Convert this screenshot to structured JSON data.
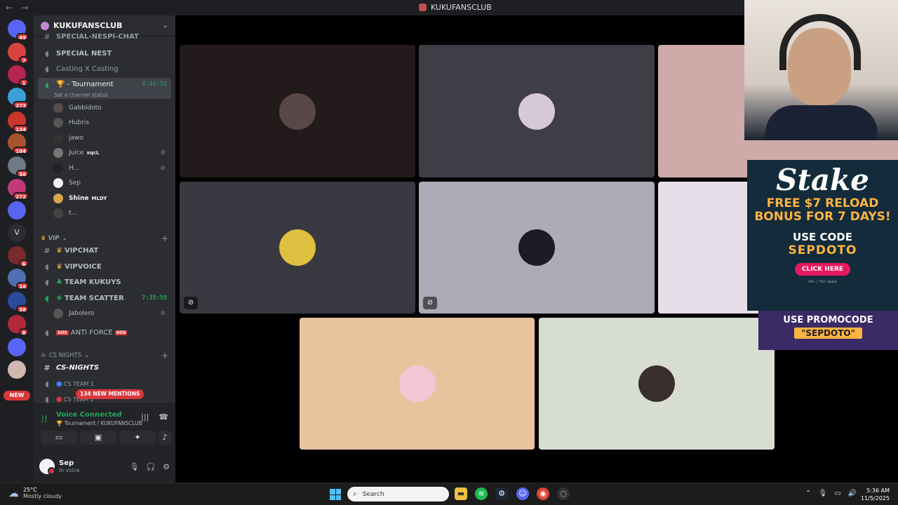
{
  "window": {
    "title": "KUKUFANSCLUB",
    "back": "←",
    "forward": "→"
  },
  "rail": {
    "dm_badge": "49",
    "servers": [
      {
        "badge": "7",
        "color": "#d8433f"
      },
      {
        "badge": "1",
        "color": "#b4254f"
      },
      {
        "badge": "273",
        "color": "#3aa0d8"
      },
      {
        "badge": "134",
        "color": "#c9372c"
      },
      {
        "badge": "104",
        "color": "#a8542f"
      },
      {
        "badge": "36",
        "color": "#6f7a85"
      },
      {
        "badge": "272",
        "color": "#c03a7a"
      },
      {
        "badge": "",
        "color": "#5865f2"
      },
      {
        "badge": "",
        "color": "#2b2d31",
        "letter": "V"
      },
      {
        "badge": "6",
        "color": "#7a2a2a"
      },
      {
        "badge": "16",
        "color": "#4f6fb0"
      },
      {
        "badge": "38",
        "color": "#2a4b9c"
      },
      {
        "badge": "8",
        "color": "#b02a3a"
      },
      {
        "badge": "",
        "color": "#5865f2"
      },
      {
        "badge": "",
        "color": "#d2b8b0"
      }
    ],
    "new_label": "NEW"
  },
  "guild": {
    "name": "KUKUFANSCLUB",
    "chevron": "⌄"
  },
  "channels": {
    "top_cut": "SPECIAL-NESPI-CHAT",
    "special_nest": "SPECIAL NEST",
    "casting": "Casting X Casting",
    "tournament": "- Tournament",
    "tournament_timer": "4:44:31",
    "tournament_status": "Set a channel status",
    "members": [
      {
        "name": "Gabbidoto",
        "color": "#5a4a4a"
      },
      {
        "name": "Hubris",
        "color": "#555"
      },
      {
        "name": "jawo",
        "color": "#333"
      },
      {
        "name": "Juice",
        "tag": "xqcL",
        "color": "#777"
      },
      {
        "name": "H...",
        "color": "#222"
      },
      {
        "name": "Sep",
        "color": "#f2f3f5"
      },
      {
        "name": "Shine",
        "tag": "MLDY",
        "color": "#d8a648"
      },
      {
        "name": "t...",
        "color": "#444"
      }
    ],
    "vip_category": "VIP",
    "vipchat": "VIPCHAT",
    "vipvoice": "VIPVOICE",
    "team_kukuys": "TEAM KUKUYS",
    "team_scatter": "TEAM SCATTER",
    "team_scatter_timer": "7:35:59",
    "jabolero": "Jabolero",
    "anti_force": "ANTI FORCE",
    "cs_category": "CS NIGHTS",
    "cs_nights": "CS-NIGHTS",
    "cs_team1": "CS TEAM 1",
    "cs_team2": "CS TEAM 2",
    "mentions": "134 NEW MENTIONS"
  },
  "voice": {
    "status": "Voice Connected",
    "location": "Tournament / KUKUFANSCLUB"
  },
  "user": {
    "name": "Sep",
    "status": "In voice"
  },
  "tiles": [
    {
      "bg": "#231a1c",
      "avatar": "#5a4848"
    },
    {
      "bg": "#3f3e46",
      "avatar": "#d7c8d8"
    },
    {
      "bg": "#cfaaa8",
      "avatar": ""
    },
    {
      "bg": "#3a3840",
      "avatar": "#e0c040"
    },
    {
      "bg": "#acacb8",
      "avatar": "#1c1c28"
    },
    {
      "bg": "#e6dfea",
      "avatar": ""
    },
    {
      "bg": "#e8c39d",
      "avatar": "#f4c6d6"
    },
    {
      "bg": "#d8ddd2",
      "avatar": "#3a2f2c"
    }
  ],
  "ad": {
    "brand": "Stake",
    "line1": "FREE $7 RELOAD",
    "line2": "BONUS FOR 7 DAYS!",
    "use_code": "USE CODE",
    "code": "SEPDOTO",
    "cta": "CLICK HERE",
    "fine": "18+ | T&C apply",
    "promo1": "USE PROMOCODE",
    "promo2": "\"SEPDOTO\""
  },
  "taskbar": {
    "temp": "25°C",
    "weather": "Mostly cloudy",
    "search_placeholder": "Search",
    "time": "5:36 AM",
    "date": "11/5/2025"
  }
}
